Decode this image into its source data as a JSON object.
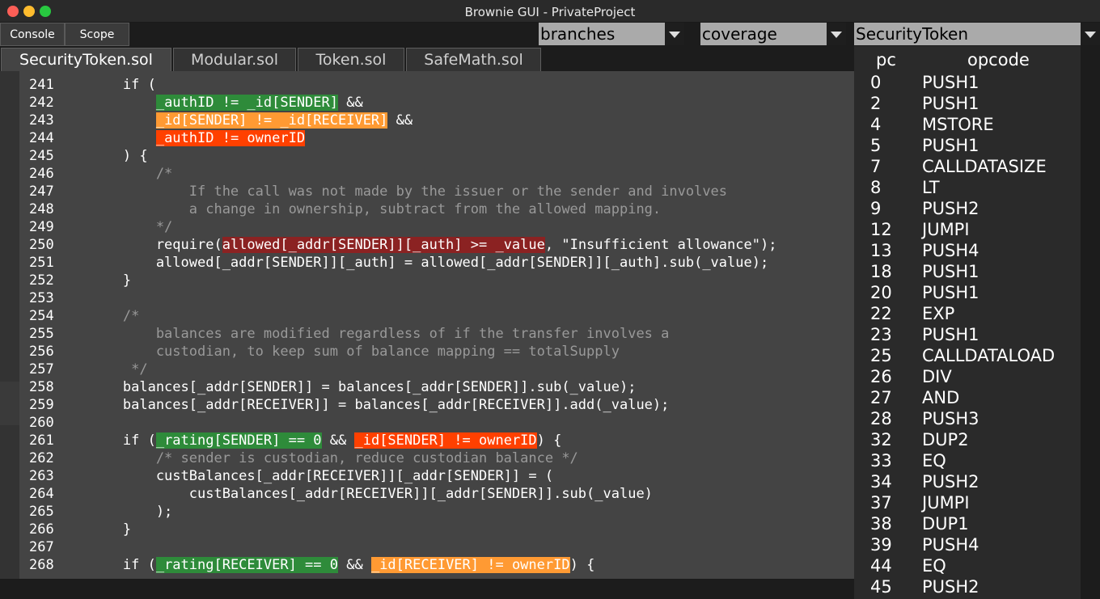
{
  "window": {
    "title": "Brownie GUI - PrivateProject"
  },
  "toolbar": {
    "console_label": "Console",
    "scope_label": "Scope",
    "branches_value": "branches",
    "coverage_value": "coverage",
    "contract_value": "SecurityToken"
  },
  "tabs": [
    {
      "label": "SecurityToken.sol"
    },
    {
      "label": "Modular.sol"
    },
    {
      "label": "Token.sol"
    },
    {
      "label": "SafeMath.sol"
    }
  ],
  "editor": {
    "lines": [
      {
        "n": "241",
        "segs": [
          {
            "t": "        if ("
          }
        ]
      },
      {
        "n": "242",
        "segs": [
          {
            "t": "            "
          },
          {
            "t": "_authID != _id[SENDER]",
            "c": "hg"
          },
          {
            "t": " &&"
          }
        ]
      },
      {
        "n": "243",
        "segs": [
          {
            "t": "            "
          },
          {
            "t": "_id[SENDER] != _id[RECEIVER]",
            "c": "ho"
          },
          {
            "t": " &&"
          }
        ]
      },
      {
        "n": "244",
        "segs": [
          {
            "t": "            "
          },
          {
            "t": "_authID != ownerID",
            "c": "hr"
          }
        ]
      },
      {
        "n": "245",
        "segs": [
          {
            "t": "        ) {"
          }
        ]
      },
      {
        "n": "246",
        "segs": [
          {
            "t": "            /*",
            "c": "cm"
          }
        ]
      },
      {
        "n": "247",
        "segs": [
          {
            "t": "                If the call was not made by the issuer or the sender and involves",
            "c": "cm"
          }
        ]
      },
      {
        "n": "248",
        "segs": [
          {
            "t": "                a change in ownership, subtract from the allowed mapping.",
            "c": "cm"
          }
        ]
      },
      {
        "n": "249",
        "segs": [
          {
            "t": "            */",
            "c": "cm"
          }
        ]
      },
      {
        "n": "250",
        "segs": [
          {
            "t": "            require("
          },
          {
            "t": "allowed[_addr[SENDER]][_auth] >= _value",
            "c": "hd"
          },
          {
            "t": ", \"Insufficient allowance\");"
          }
        ]
      },
      {
        "n": "251",
        "segs": [
          {
            "t": "            allowed[_addr[SENDER]][_auth] = allowed[_addr[SENDER]][_auth].sub(_value);"
          }
        ]
      },
      {
        "n": "252",
        "segs": [
          {
            "t": "        }"
          }
        ]
      },
      {
        "n": "253",
        "segs": [
          {
            "t": ""
          }
        ]
      },
      {
        "n": "254",
        "segs": [
          {
            "t": "        /*",
            "c": "cm"
          }
        ]
      },
      {
        "n": "255",
        "segs": [
          {
            "t": "            balances are modified regardless of if the transfer involves a",
            "c": "cm"
          }
        ]
      },
      {
        "n": "256",
        "segs": [
          {
            "t": "            custodian, to keep sum of balance mapping == totalSupply",
            "c": "cm"
          }
        ]
      },
      {
        "n": "257",
        "segs": [
          {
            "t": "         */",
            "c": "cm"
          }
        ]
      },
      {
        "n": "258",
        "segs": [
          {
            "t": "        balances[_addr[SENDER]] = balances[_addr[SENDER]].sub(_value);"
          }
        ]
      },
      {
        "n": "259",
        "segs": [
          {
            "t": "        balances[_addr[RECEIVER]] = balances[_addr[RECEIVER]].add(_value);"
          }
        ]
      },
      {
        "n": "260",
        "segs": [
          {
            "t": ""
          }
        ]
      },
      {
        "n": "261",
        "segs": [
          {
            "t": "        if ("
          },
          {
            "t": "_rating[SENDER] == 0",
            "c": "hg"
          },
          {
            "t": " && "
          },
          {
            "t": "_id[SENDER] != ownerID",
            "c": "hr"
          },
          {
            "t": ") {"
          }
        ]
      },
      {
        "n": "262",
        "segs": [
          {
            "t": "            /* sender is custodian, reduce custodian balance */",
            "c": "cm"
          }
        ]
      },
      {
        "n": "263",
        "segs": [
          {
            "t": "            custBalances[_addr[RECEIVER]][_addr[SENDER]] = ("
          }
        ]
      },
      {
        "n": "264",
        "segs": [
          {
            "t": "                custBalances[_addr[RECEIVER]][_addr[SENDER]].sub(_value)"
          }
        ]
      },
      {
        "n": "265",
        "segs": [
          {
            "t": "            );"
          }
        ]
      },
      {
        "n": "266",
        "segs": [
          {
            "t": "        }"
          }
        ]
      },
      {
        "n": "267",
        "segs": [
          {
            "t": ""
          }
        ]
      },
      {
        "n": "268",
        "segs": [
          {
            "t": "        if ("
          },
          {
            "t": "_rating[RECEIVER] == 0",
            "c": "hg"
          },
          {
            "t": " && "
          },
          {
            "t": "_id[RECEIVER] != ownerID",
            "c": "ho"
          },
          {
            "t": ") {"
          }
        ]
      }
    ]
  },
  "opcodes": {
    "header_pc": "pc",
    "header_opcode": "opcode",
    "rows": [
      {
        "pc": "0",
        "op": "PUSH1"
      },
      {
        "pc": "2",
        "op": "PUSH1"
      },
      {
        "pc": "4",
        "op": "MSTORE"
      },
      {
        "pc": "5",
        "op": "PUSH1"
      },
      {
        "pc": "7",
        "op": "CALLDATASIZE"
      },
      {
        "pc": "8",
        "op": "LT"
      },
      {
        "pc": "9",
        "op": "PUSH2"
      },
      {
        "pc": "12",
        "op": "JUMPI"
      },
      {
        "pc": "13",
        "op": "PUSH4"
      },
      {
        "pc": "18",
        "op": "PUSH1"
      },
      {
        "pc": "20",
        "op": "PUSH1"
      },
      {
        "pc": "22",
        "op": "EXP"
      },
      {
        "pc": "23",
        "op": "PUSH1"
      },
      {
        "pc": "25",
        "op": "CALLDATALOAD"
      },
      {
        "pc": "26",
        "op": "DIV"
      },
      {
        "pc": "27",
        "op": "AND"
      },
      {
        "pc": "28",
        "op": "PUSH3"
      },
      {
        "pc": "32",
        "op": "DUP2"
      },
      {
        "pc": "33",
        "op": "EQ"
      },
      {
        "pc": "34",
        "op": "PUSH2"
      },
      {
        "pc": "37",
        "op": "JUMPI"
      },
      {
        "pc": "38",
        "op": "DUP1"
      },
      {
        "pc": "39",
        "op": "PUSH4"
      },
      {
        "pc": "44",
        "op": "EQ"
      },
      {
        "pc": "45",
        "op": "PUSH2"
      }
    ]
  }
}
